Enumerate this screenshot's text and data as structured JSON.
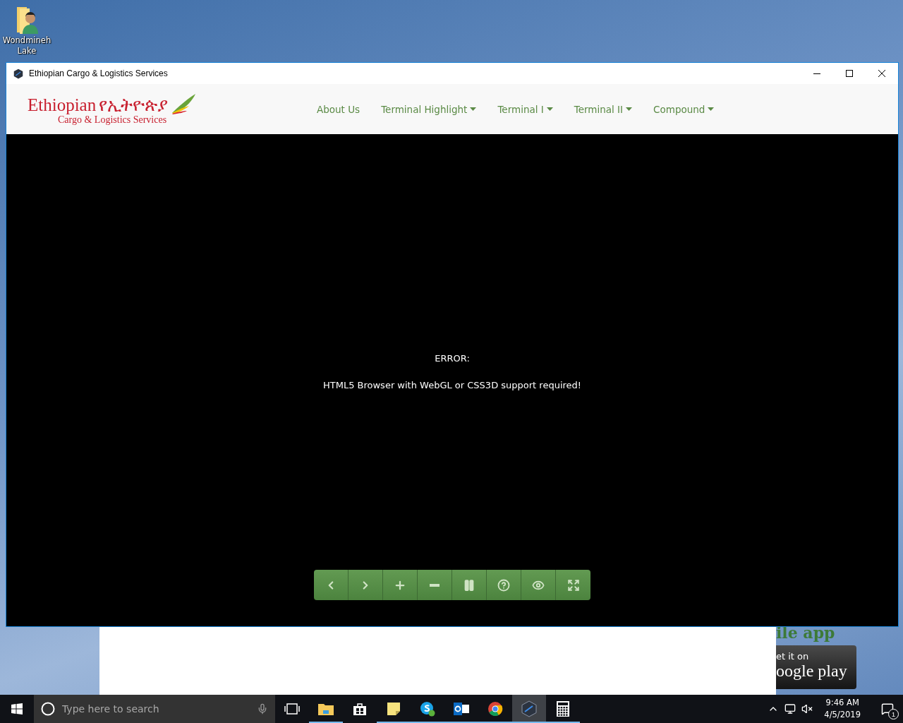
{
  "desktop_icon": {
    "label_lines": [
      "Wondmineh",
      "Lake"
    ]
  },
  "background_window": {
    "heading": "ile app",
    "badge_line1": "et it on",
    "badge_line2": "oogle play"
  },
  "window": {
    "title": "Ethiopian Cargo & Logistics Services",
    "controls": [
      {
        "kind": "minimize"
      },
      {
        "kind": "maximize"
      },
      {
        "kind": "close"
      }
    ]
  },
  "header": {
    "logo": {
      "name": "Ethiopian",
      "amharic": "የኢትዮጵያ",
      "subtitle": "Cargo & Logistics Services"
    },
    "nav": [
      {
        "label": "About Us",
        "dropdown": false
      },
      {
        "label": "Terminal Highlight",
        "dropdown": true
      },
      {
        "label": "Terminal I",
        "dropdown": true
      },
      {
        "label": "Terminal II",
        "dropdown": true
      },
      {
        "label": "Compound",
        "dropdown": true
      }
    ]
  },
  "viewer": {
    "error_title": "ERROR:",
    "error_message": "HTML5 Browser with WebGL or CSS3D support required!",
    "toolbar": [
      {
        "kind": "back"
      },
      {
        "kind": "forward"
      },
      {
        "kind": "zoom-in"
      },
      {
        "kind": "zoom-out"
      },
      {
        "kind": "pause"
      },
      {
        "kind": "help"
      },
      {
        "kind": "view"
      },
      {
        "kind": "fullscreen"
      }
    ]
  },
  "taskbar": {
    "search": {
      "placeholder": "Type here to search"
    },
    "apps": [
      {
        "kind": "taskview",
        "running": false,
        "active": false
      },
      {
        "kind": "explorer",
        "running": true,
        "active": false
      },
      {
        "kind": "store",
        "running": false,
        "active": false
      },
      {
        "kind": "notes",
        "running": true,
        "active": false
      },
      {
        "kind": "skype",
        "running": true,
        "active": false
      },
      {
        "kind": "outlook",
        "running": true,
        "active": false
      },
      {
        "kind": "chrome",
        "running": true,
        "active": false
      },
      {
        "kind": "viewer",
        "running": true,
        "active": true
      },
      {
        "kind": "calculator",
        "running": true,
        "active": false
      }
    ],
    "clock": {
      "time": "9:46 AM",
      "date": "4/5/2019"
    },
    "notifications": {
      "count": "1"
    }
  }
}
